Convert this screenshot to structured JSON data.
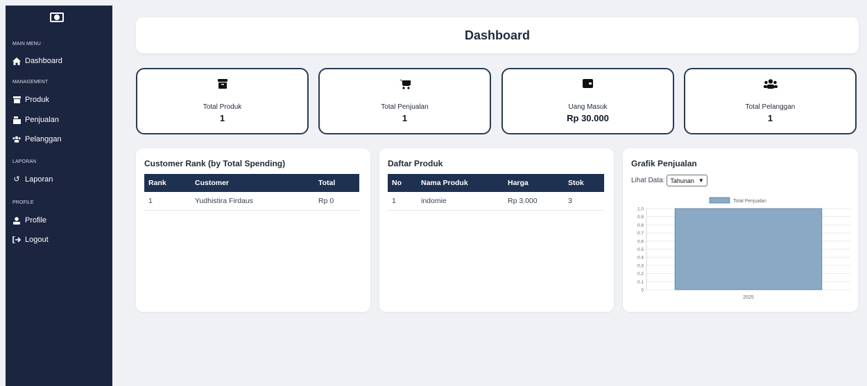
{
  "sidebar": {
    "logo_icon": "money-bill-icon",
    "sections": {
      "main_menu": "MAIN MENU",
      "management": "MANAGEMENT",
      "laporan": "LAPORAN",
      "profile": "PROFILE"
    },
    "items": {
      "dashboard": "Dashboard",
      "produk": "Produk",
      "penjualan": "Penjualan",
      "pelanggan": "Pelanggan",
      "laporan": "Laporan",
      "profile": "Profile",
      "logout": "Logout"
    }
  },
  "header": {
    "title": "Dashboard"
  },
  "stats": [
    {
      "label": "Total Produk",
      "value": "1",
      "icon": "box-icon"
    },
    {
      "label": "Total Penjualan",
      "value": "1",
      "icon": "cart-icon"
    },
    {
      "label": "Uang Masuk",
      "value": "Rp 30.000",
      "icon": "wallet-icon"
    },
    {
      "label": "Total Pelanggan",
      "value": "1",
      "icon": "users-icon"
    }
  ],
  "customer_rank": {
    "title": "Customer Rank (by Total Spending)",
    "headers": [
      "Rank",
      "Customer",
      "Total"
    ],
    "rows": [
      [
        "1",
        "Yudhistira Firdaus",
        "Rp 0"
      ]
    ]
  },
  "produk": {
    "title": "Daftar Produk",
    "headers": [
      "No",
      "Nama Produk",
      "Harga",
      "Stok"
    ],
    "rows": [
      [
        "1",
        "indomie",
        "Rp 3.000",
        "3"
      ]
    ]
  },
  "grafik": {
    "title": "Grafik Penjualan",
    "select_label": "Lihat Data:",
    "select_value": "Tahunan"
  },
  "chart_data": {
    "type": "bar",
    "categories": [
      "2025"
    ],
    "series": [
      {
        "name": "Total Penjualan",
        "values": [
          1
        ]
      }
    ],
    "ylim": [
      0,
      1
    ],
    "yticks": [
      "0",
      "0.1",
      "0.2",
      "0.3",
      "0.4",
      "0.5",
      "0.6",
      "0.7",
      "0.8",
      "0.9",
      "1.0"
    ],
    "legend": "top",
    "grid": true,
    "color": "#8aa9c4"
  }
}
